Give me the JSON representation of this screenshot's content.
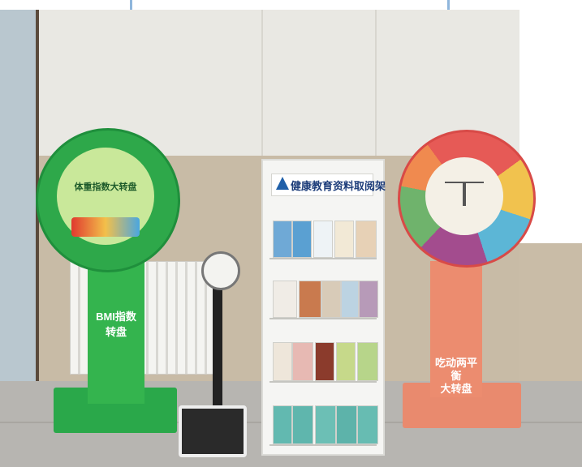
{
  "scene": {
    "bmi_disc": {
      "title": "体重指数大转盘",
      "post_text": "BMI指数转盘"
    },
    "rack": {
      "title": "健康教育资料取阅架"
    },
    "diet_disc": {
      "post_text_line1": "吃动两平衡",
      "post_text_line2": "大转盘"
    },
    "colors": {
      "green": "#34b44e",
      "orange": "#ec8c6f",
      "rack_blue": "#1d3d7a"
    }
  }
}
